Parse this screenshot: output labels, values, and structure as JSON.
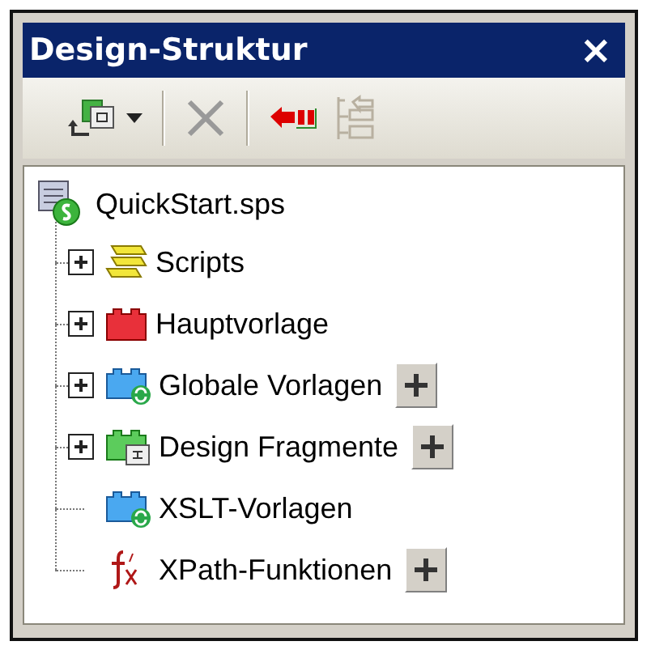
{
  "window": {
    "title": "Design-Struktur",
    "close": "×"
  },
  "toolbar": [
    {
      "kind": "add",
      "disabled": false,
      "dropdown": true
    },
    {
      "kind": "separator"
    },
    {
      "kind": "delete",
      "disabled": true,
      "dropdown": false
    },
    {
      "kind": "separator"
    },
    {
      "kind": "back",
      "disabled": false,
      "dropdown": false
    },
    {
      "kind": "tree",
      "disabled": true,
      "dropdown": false
    }
  ],
  "tree": {
    "label": "QuickStart.sps",
    "children": [
      {
        "label": "Scripts",
        "kind": "script",
        "expanded": false,
        "add_button": false
      },
      {
        "label": "Hauptvorlage",
        "kind": "main",
        "expanded": false,
        "add_button": false
      },
      {
        "label": "Globale Vorlagen",
        "kind": "global",
        "expanded": false,
        "add_button": true
      },
      {
        "label": "Design Fragmente",
        "kind": "fragment",
        "expanded": false,
        "add_button": true
      },
      {
        "label": "XSLT-Vorlagen",
        "kind": "xslt",
        "add_button": false
      },
      {
        "label": "XPath-Funktionen",
        "kind": "xpath",
        "add_button": true
      }
    ]
  }
}
